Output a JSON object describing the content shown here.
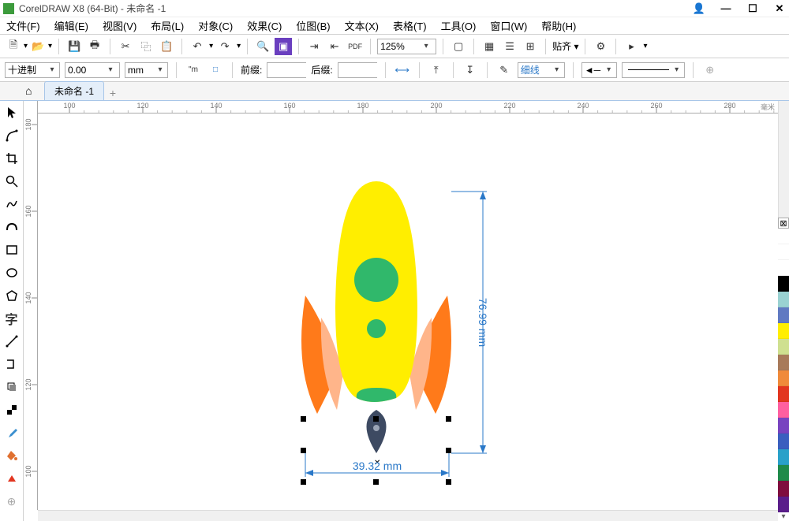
{
  "titlebar": {
    "title": "CorelDRAW X8 (64-Bit) - 未命名 -1"
  },
  "menu": {
    "file": "文件(F)",
    "edit": "编辑(E)",
    "view": "视图(V)",
    "layout": "布局(L)",
    "object": "对象(C)",
    "effect": "效果(C)",
    "bitmap": "位图(B)",
    "text": "文本(X)",
    "table": "表格(T)",
    "tools": "工具(O)",
    "window": "窗口(W)",
    "help": "帮助(H)"
  },
  "toolbar": {
    "zoom": "125%",
    "align_label": "贴齐 ▾"
  },
  "propbar": {
    "format": "十进制",
    "value": "0.00",
    "unit": "mm",
    "prefix_label": "前缀:",
    "prefix_val": "",
    "suffix_label": "后缀:",
    "suffix_val": "",
    "outline": "细线"
  },
  "tabs": {
    "doc": "未命名 -1"
  },
  "ruler": {
    "hlabel": "毫米",
    "hticks": [
      "100",
      "120",
      "140",
      "160",
      "180",
      "200",
      "220",
      "240",
      "260",
      "280"
    ],
    "vticks": [
      "180",
      "160",
      "140",
      "120",
      "100"
    ]
  },
  "dims": {
    "w": "39.32 mm",
    "h": "76.99 mm"
  },
  "palette": {
    "colors": [
      "#ffffff",
      "#ffffff",
      "#ffffff",
      "#000000",
      "#9ad2d2",
      "#6079c2",
      "#ffee00",
      "#cfe090",
      "#a87a5a",
      "#f08a3a",
      "#e2351f",
      "#ff5fa0",
      "#7843c0",
      "#3a5fbf",
      "#29a1c9",
      "#1f8a4a",
      "#7f0d3e",
      "#5a1d8a"
    ]
  }
}
